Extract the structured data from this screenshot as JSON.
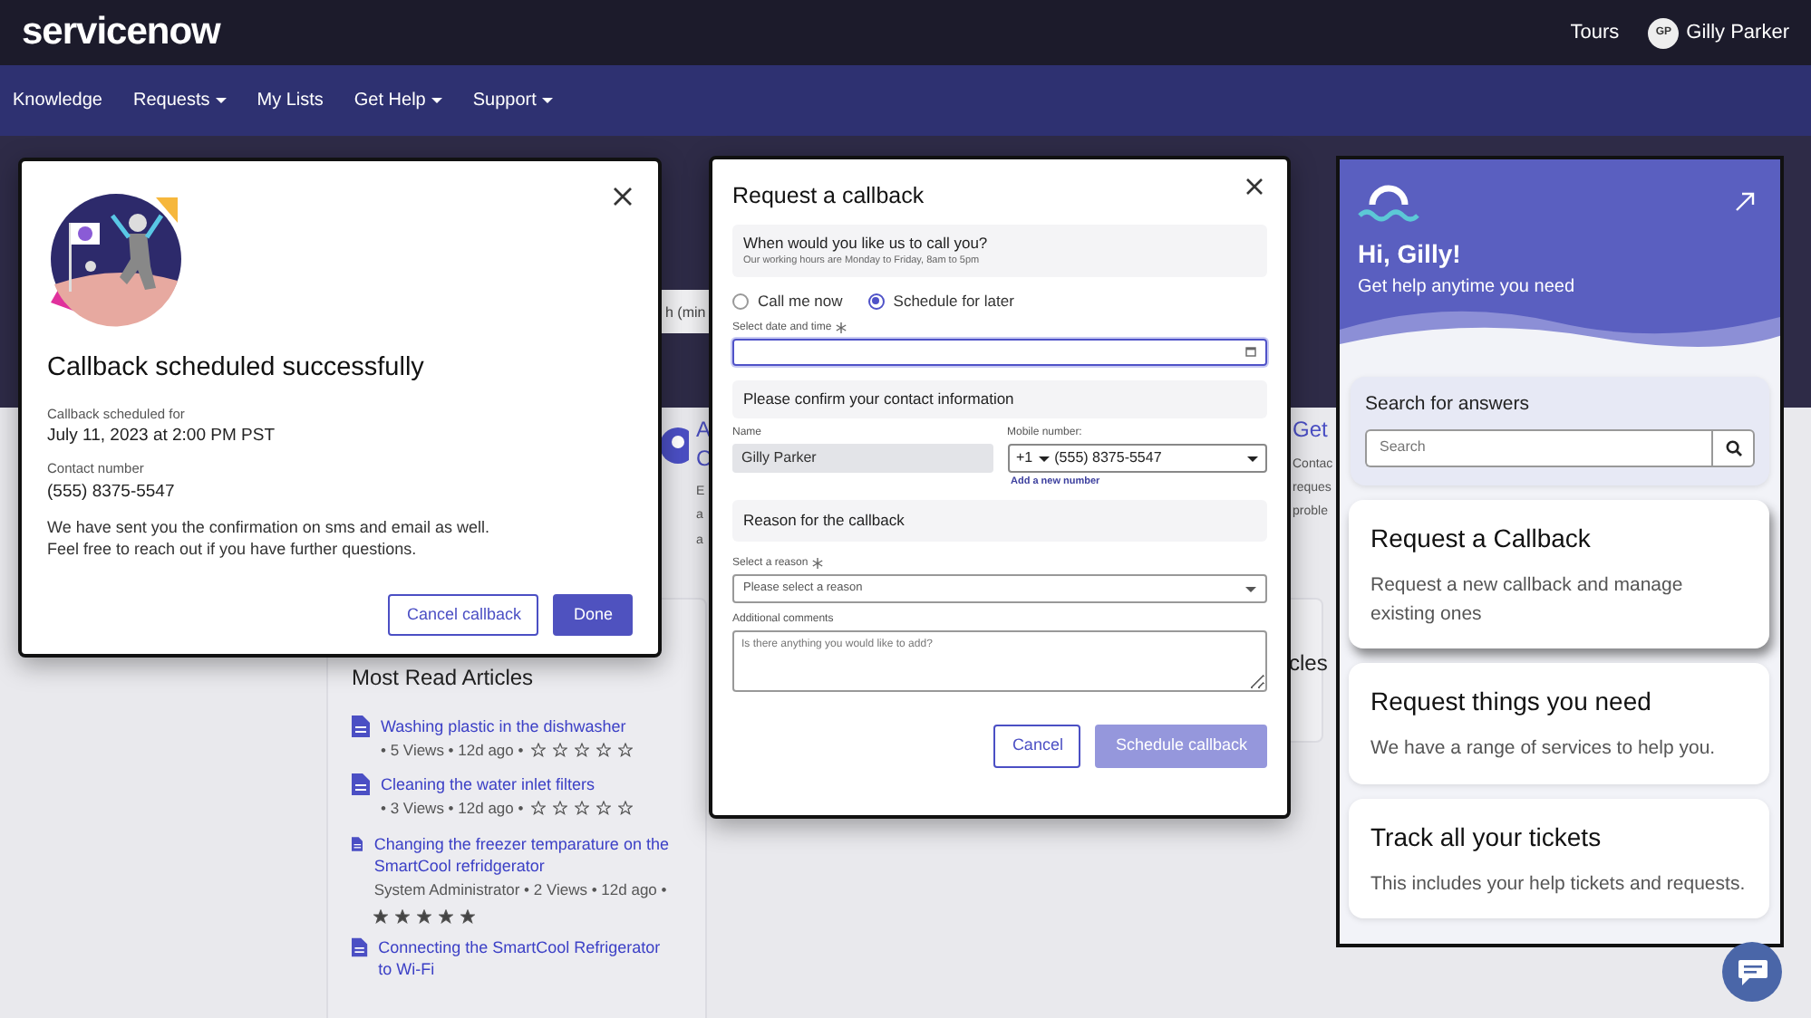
{
  "header": {
    "logo": "servicenow",
    "links": [
      "Tours"
    ],
    "user": {
      "initials": "GP",
      "name": "Gilly Parker"
    }
  },
  "nav": [
    {
      "label": "Knowledge",
      "dropdown": false
    },
    {
      "label": "Requests",
      "dropdown": true
    },
    {
      "label": "My Lists",
      "dropdown": false
    },
    {
      "label": "Get Help",
      "dropdown": true
    },
    {
      "label": "Support",
      "dropdown": true
    }
  ],
  "hero": {
    "search_value": "h (min"
  },
  "features": [
    {
      "title_lines": [
        "A",
        "C"
      ],
      "desc_lines": [
        "E",
        "a",
        "a"
      ],
      "icon": true
    },
    {
      "title_lines": [
        "Get"
      ],
      "desc_lines": [
        "Contac",
        "reques",
        "proble"
      ],
      "icon": false
    }
  ],
  "most_read": {
    "heading": "Most Read Articles",
    "articles": [
      {
        "title": "Washing plastic in the dishwasher",
        "meta": "• 5 Views • 12d ago •",
        "stars": 0
      },
      {
        "title": "Cleaning the water inlet filters",
        "meta": "• 3 Views • 12d ago •",
        "stars": 0
      },
      {
        "title": "Changing the freezer temparature on the SmartCool refridgerator",
        "meta": "System Administrator • 2 Views • 12d ago •",
        "stars": 5
      },
      {
        "title": "Connecting the SmartCool Refrigerator to Wi-Fi"
      }
    ]
  },
  "side_card_heading": "cles",
  "success_dialog": {
    "title": "Callback scheduled successfully",
    "details": [
      {
        "label": "Callback scheduled for",
        "value": "July 11, 2023 at 2:00 PM PST"
      },
      {
        "label": "Contact number",
        "value": "(555) 8375-5547"
      }
    ],
    "message": [
      "We have sent you the confirmation on sms and email as well.",
      "Feel free to reach out if you have further questions."
    ],
    "buttons": [
      {
        "label": "Cancel callback",
        "kind": "secondary"
      },
      {
        "label": "Done",
        "kind": "primary"
      }
    ]
  },
  "callback_dialog": {
    "title": "Request a callback",
    "when": {
      "heading": "When would you like us to call you?",
      "hint": "Our working hours are Monday to Friday, 8am to 5pm"
    },
    "options": [
      {
        "label": "Call me now",
        "selected": false
      },
      {
        "label": "Schedule for later",
        "selected": true
      }
    ],
    "date_field": {
      "label": "Select date and time",
      "required": true,
      "focused": true
    },
    "contact_heading": "Please confirm your contact information",
    "name_field": {
      "label": "Name",
      "value": "Gilly Parker"
    },
    "phone_field": {
      "label": "Mobile number:",
      "code": "+1",
      "value": "(555) 8375-5547"
    },
    "add_number": "Add a new number",
    "reason_heading": "Reason for the callback",
    "reason_field": {
      "label": "Select a reason",
      "required": true,
      "placeholder": "Please select a reason"
    },
    "comments_field": {
      "label": "Additional comments",
      "placeholder": "Is there anything you would like to add?"
    },
    "buttons": [
      {
        "label": "Cancel",
        "kind": "secondary",
        "disabled": false
      },
      {
        "label": "Schedule callback",
        "kind": "primary",
        "disabled": true
      }
    ]
  },
  "assistant": {
    "greeting": "Hi, Gilly!",
    "subtitle": "Get help anytime you need",
    "search": {
      "heading": "Search for answers",
      "placeholder": "Search"
    },
    "cards": [
      {
        "title": "Request a Callback",
        "text": "Request a new callback and manage existing ones",
        "selected": true
      },
      {
        "title": "Request things you need",
        "text": "We have a range of services to help you.",
        "selected": false
      },
      {
        "title": "Track all your tickets",
        "text": "This includes your help tickets and requests.",
        "selected": false
      }
    ]
  }
}
